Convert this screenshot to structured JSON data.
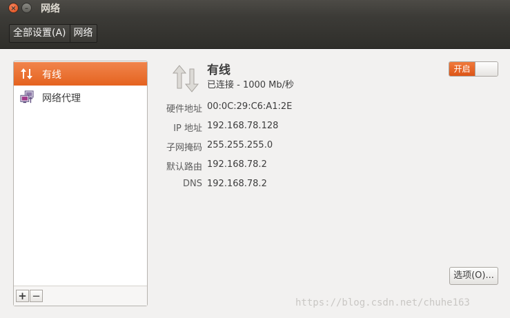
{
  "window": {
    "title": "网络",
    "close_glyph": "×",
    "minimize_glyph": "–"
  },
  "toolbar": {
    "crumbs": [
      "全部设置(A)",
      "网络"
    ]
  },
  "sidebar": {
    "items": [
      {
        "label": "有线",
        "icon": "wired-network-icon",
        "selected": true
      },
      {
        "label": "网络代理",
        "icon": "network-proxy-icon",
        "selected": false
      }
    ],
    "add_label": "+",
    "remove_label": "−"
  },
  "device": {
    "name": "有线",
    "status": "已连接 - 1000 Mb/秒",
    "switch_label": "开启",
    "switch_on": true,
    "details": [
      {
        "label": "硬件地址",
        "value": "00:0C:29:C6:A1:2E"
      },
      {
        "label": "IP 地址",
        "value": "192.168.78.128"
      },
      {
        "label": "子网掩码",
        "value": "255.255.255.0"
      },
      {
        "label": "默认路由",
        "value": "192.168.78.2"
      },
      {
        "label": "DNS",
        "value": "192.168.78.2"
      }
    ],
    "options_label": "选项(O)..."
  },
  "watermark": "https://blog.csdn.net/chuhe163",
  "colors": {
    "accent": "#e5631f",
    "titlebar": "#3c3b37",
    "background": "#f2f1f0"
  }
}
